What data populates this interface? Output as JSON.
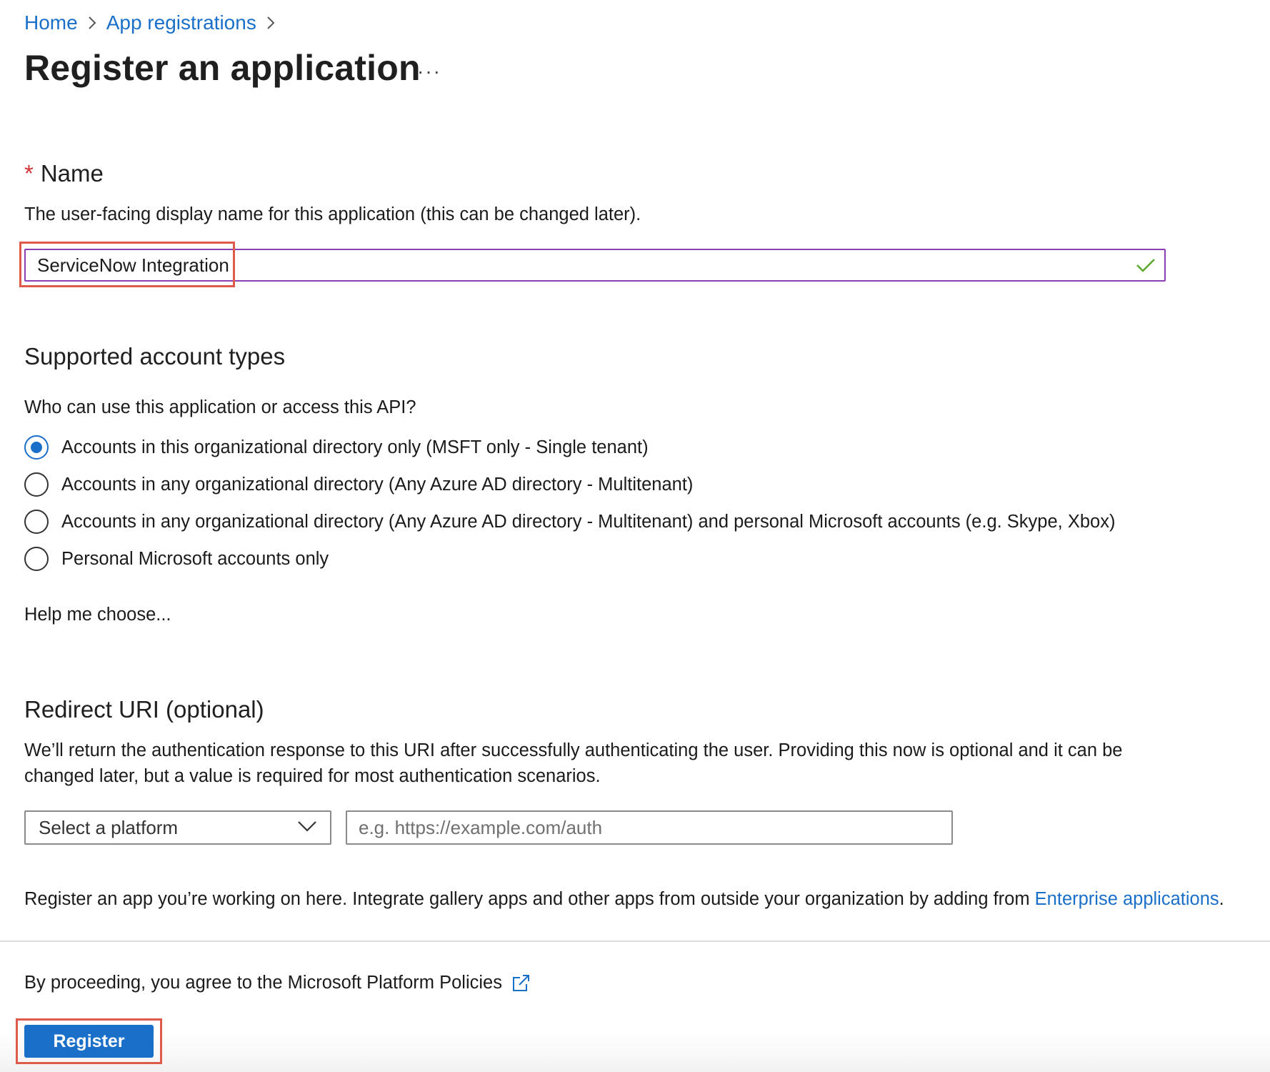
{
  "breadcrumb": {
    "items": [
      "Home",
      "App registrations"
    ]
  },
  "page": {
    "title": "Register an application",
    "more_label": "···"
  },
  "name_section": {
    "required_marker": "*",
    "label": "Name",
    "description": "The user-facing display name for this application (this can be changed later).",
    "value": "ServiceNow Integration",
    "valid_icon": "checkmark-icon"
  },
  "account_types": {
    "heading": "Supported account types",
    "question": "Who can use this application or access this API?",
    "options": [
      {
        "label": "Accounts in this organizational directory only (MSFT only - Single tenant)",
        "selected": true
      },
      {
        "label": "Accounts in any organizational directory (Any Azure AD directory - Multitenant)",
        "selected": false
      },
      {
        "label": "Accounts in any organizational directory (Any Azure AD directory - Multitenant) and personal Microsoft accounts (e.g. Skype, Xbox)",
        "selected": false
      },
      {
        "label": "Personal Microsoft accounts only",
        "selected": false
      }
    ],
    "help_link": "Help me choose..."
  },
  "redirect": {
    "heading": "Redirect URI (optional)",
    "description_line1": "We’ll return the authentication response to this URI after successfully authenticating the user. Providing this now is optional and it can be",
    "description_line2": "changed later, but a value is required for most authentication scenarios.",
    "platform_select": "Select a platform",
    "uri_placeholder": "e.g. https://example.com/auth"
  },
  "info": {
    "text": "Register an app you’re working on here. Integrate gallery apps and other apps from outside your organization by adding from ",
    "link": "Enterprise applications",
    "suffix": "."
  },
  "footer": {
    "policy_link": "By proceeding, you agree to the Microsoft Platform Policies",
    "register_label": "Register"
  },
  "colors": {
    "accent": "#1a6fc9",
    "required": "#d13438",
    "input_focus_border": "#8b3fb2",
    "valid_check": "#5ba82f",
    "highlight_box": "#e05a4c"
  }
}
